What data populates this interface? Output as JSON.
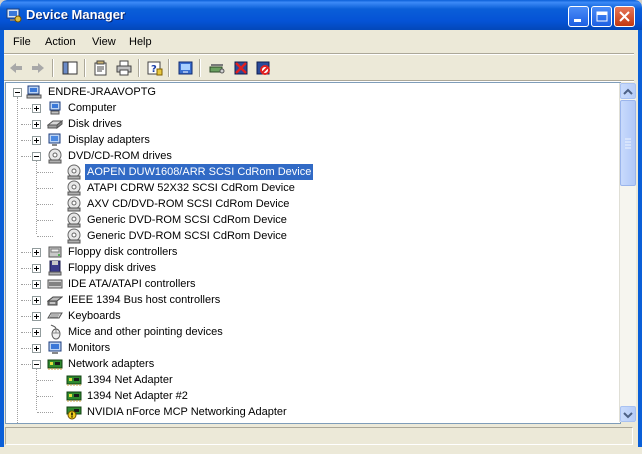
{
  "window": {
    "title": "Device Manager",
    "controls": [
      "minimize",
      "maximize",
      "close"
    ]
  },
  "menu": {
    "items": [
      "File",
      "Action",
      "View",
      "Help"
    ]
  },
  "toolbar": {
    "buttons": [
      "back-icon",
      "forward-icon",
      "show-hide-console-tree-icon",
      "properties-icon",
      "print-icon",
      "help-icon",
      "update-driver-icon",
      "scan-hardware-icon",
      "uninstall-icon",
      "disable-icon"
    ]
  },
  "tree": {
    "root": "ENDRE-JRAAVOPTG",
    "categories": [
      {
        "label": "Computer",
        "expanded": false
      },
      {
        "label": "Disk drives",
        "expanded": false
      },
      {
        "label": "Display adapters",
        "expanded": false
      },
      {
        "label": "DVD/CD-ROM drives",
        "expanded": true,
        "children": [
          {
            "label": "AOPEN DUW1608/ARR SCSI CdRom Device",
            "selected": true
          },
          {
            "label": "ATAPI CDRW 52X32 SCSI CdRom Device"
          },
          {
            "label": "AXV CD/DVD-ROM SCSI CdRom Device"
          },
          {
            "label": "Generic DVD-ROM SCSI CdRom Device"
          },
          {
            "label": "Generic DVD-ROM SCSI CdRom Device"
          }
        ]
      },
      {
        "label": "Floppy disk controllers",
        "expanded": false
      },
      {
        "label": "Floppy disk drives",
        "expanded": false
      },
      {
        "label": "IDE ATA/ATAPI controllers",
        "expanded": false
      },
      {
        "label": "IEEE 1394 Bus host controllers",
        "expanded": false
      },
      {
        "label": "Keyboards",
        "expanded": false
      },
      {
        "label": "Mice and other pointing devices",
        "expanded": false
      },
      {
        "label": "Monitors",
        "expanded": false
      },
      {
        "label": "Network adapters",
        "expanded": true,
        "children": [
          {
            "label": "1394 Net Adapter"
          },
          {
            "label": "1394 Net Adapter #2"
          },
          {
            "label": "NVIDIA nForce MCP Networking Adapter",
            "warning": true
          }
        ]
      }
    ]
  },
  "colors": {
    "titlebar": "#0a5fd8",
    "selection": "#316ac5",
    "chrome": "#ece9d8"
  }
}
